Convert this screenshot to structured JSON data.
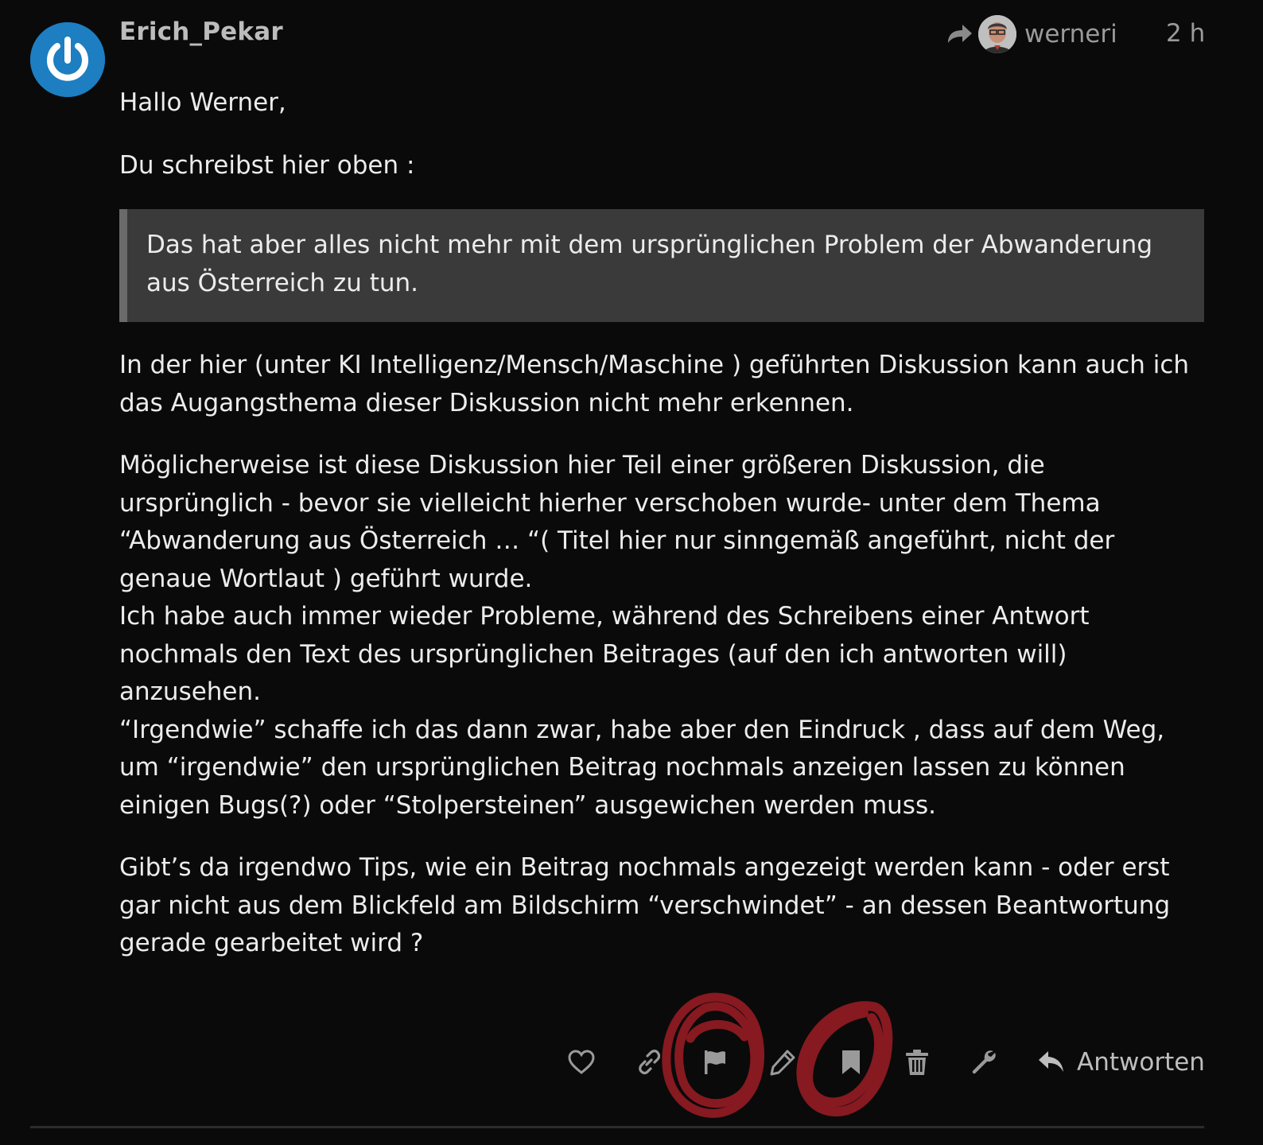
{
  "post": {
    "author": "Erich_Pekar",
    "reply_to_user": "werneri",
    "age": "2 h",
    "greeting": "Hallo Werner,",
    "intro": "Du schreibst hier oben :",
    "quote": "Das hat aber alles nicht mehr mit dem ursprünglichen Problem der Abwanderung aus Österreich zu tun.",
    "paragraph_1": "In der hier (unter KI Intelligenz/Mensch/Maschine ) geführten Diskussion kann auch ich das Augangsthema dieser Diskussion nicht mehr erkennen.",
    "paragraph_2a": "Möglicherweise ist diese Diskussion hier Teil einer größeren Diskussion, die ursprünglich - bevor sie vielleicht hierher verschoben wurde- unter dem Thema “Abwanderung aus Österreich … “( Titel hier nur sinngemäß angeführt, nicht der genaue Wortlaut ) geführt wurde.",
    "paragraph_2b": "Ich habe auch immer wieder Probleme, während des Schreibens einer Antwort nochmals den Text des ursprünglichen Beitrages (auf den ich antworten will) anzusehen.",
    "paragraph_2c": "“Irgendwie” schaffe ich das dann zwar, habe aber den Eindruck , dass auf dem Weg, um “irgendwie” den ursprünglichen Beitrag nochmals anzeigen lassen zu können einigen Bugs(?) oder “Stolpersteinen” ausgewichen werden muss.",
    "paragraph_3": "Gibt’s da irgendwo Tips, wie ein Beitrag nochmals angezeigt werden kann - oder erst gar nicht aus dem Blickfeld am Bildschirm “verschwindet” - an dessen Beantwortung gerade gearbeitet wird ?"
  },
  "actions": {
    "icons": [
      "heart-icon",
      "link-icon",
      "flag-icon",
      "pencil-icon",
      "bookmark-icon",
      "trash-icon",
      "wrench-icon",
      "reply-arrow-icon"
    ],
    "reply_label": "Antworten"
  },
  "colors": {
    "background": "#0a0a0a",
    "text": "#ececec",
    "muted": "#9a9a9a",
    "quote_bg": "#3a3a3a",
    "quote_border": "#6a6a6a",
    "avatar_blue": "#1d7ec2",
    "annotation_red": "#8e1a22"
  }
}
